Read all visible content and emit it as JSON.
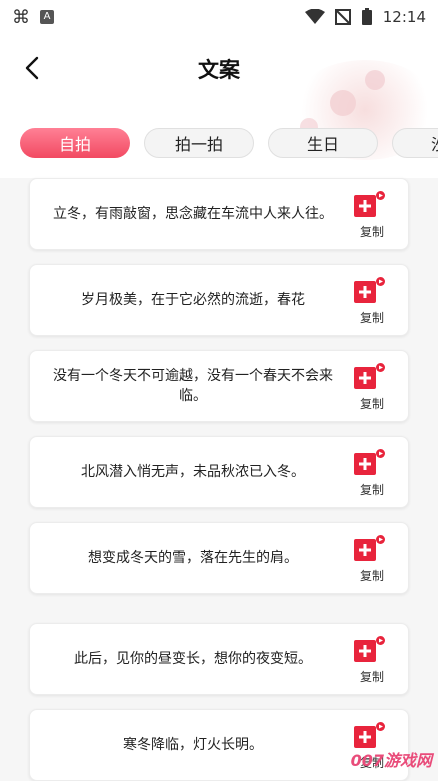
{
  "status_bar": {
    "time": "12:14"
  },
  "header": {
    "title": "文案"
  },
  "tabs": [
    {
      "label": "自拍",
      "active": true
    },
    {
      "label": "拍一拍",
      "active": false
    },
    {
      "label": "生日",
      "active": false
    },
    {
      "label": "沙雕",
      "active": false
    }
  ],
  "cards": [
    {
      "text": "立冬，有雨敲窗，思念藏在车流中人来人往。",
      "copy_label": "复制"
    },
    {
      "text": "岁月极美，在于它必然的流逝，春花",
      "copy_label": "复制"
    },
    {
      "text": "没有一个冬天不可逾越，没有一个春天不会来临。",
      "copy_label": "复制"
    },
    {
      "text": "北风潜入悄无声，未品秋浓已入冬。",
      "copy_label": "复制"
    },
    {
      "text": "想变成冬天的雪，落在先生的肩。",
      "copy_label": "复制"
    },
    {
      "text": "此后，见你的昼变长，想你的夜变短。",
      "copy_label": "复制"
    },
    {
      "text": "寒冬降临，灯火长明。",
      "copy_label": "复制"
    }
  ],
  "watermark": {
    "text": "007游戏网"
  },
  "colors": {
    "accent": "#f24a62",
    "copy_icon": "#e8243c"
  }
}
